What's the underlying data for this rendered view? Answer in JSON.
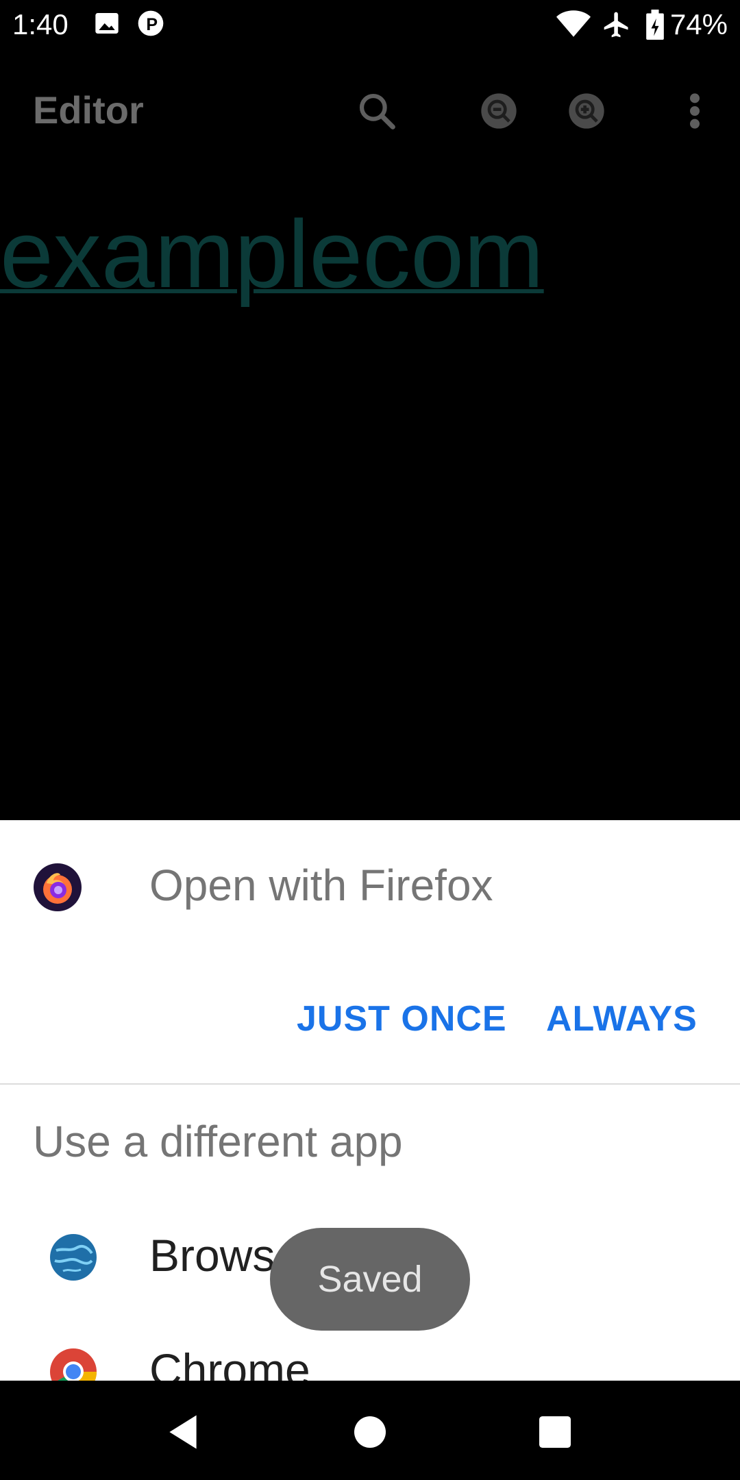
{
  "status_bar": {
    "time": "1:40",
    "battery_percent": "74%",
    "icons": [
      "image-icon",
      "p-icon",
      "wifi-icon",
      "airplane-icon",
      "battery-charging-icon"
    ]
  },
  "app_bar": {
    "title": "Editor",
    "actions": [
      "search-icon",
      "zoom-out-icon",
      "zoom-in-icon",
      "more-vert-icon"
    ]
  },
  "editor": {
    "text": "examplecom",
    "text_color": "#0b3a38"
  },
  "chooser": {
    "open_with": "Open with Firefox",
    "just_once": "JUST ONCE",
    "always": "ALWAYS",
    "different_app_label": "Use a different app",
    "apps": [
      {
        "label": "Browser",
        "icon": "browser-globe-icon"
      },
      {
        "label": "Chrome",
        "icon": "chrome-icon"
      }
    ],
    "accent_color": "#1a73e8"
  },
  "toast": {
    "text": "Saved"
  },
  "nav_bar": {
    "buttons": [
      "back-icon",
      "home-icon",
      "recents-icon"
    ]
  }
}
